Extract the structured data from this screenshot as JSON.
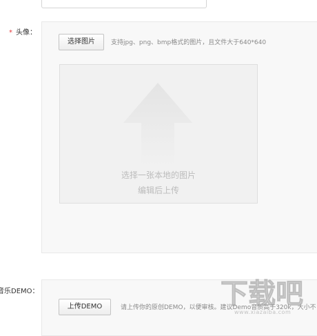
{
  "avatar": {
    "required_mark": "*",
    "label": "头像：",
    "select_button": "选择图片",
    "hint": "支持jpg、png、bmp格式的图片，且文件大于640*640",
    "upload_line1": "选择一张本地的图片",
    "upload_line2": "编辑后上传"
  },
  "music": {
    "label": "音乐DEMO：",
    "upload_button": "上传DEMO",
    "hint": "请上传你的原创DEMO，以便审核。建议Demo音质高于320k，大小不"
  },
  "watermark": {
    "text": "下载吧",
    "url": "www.xiazaiba.com"
  },
  "colors": {
    "required": "#e4393c",
    "panel_bg": "#f8f8f8",
    "upload_bg": "#f1f1f1",
    "arrow": "#e6e6e6"
  }
}
